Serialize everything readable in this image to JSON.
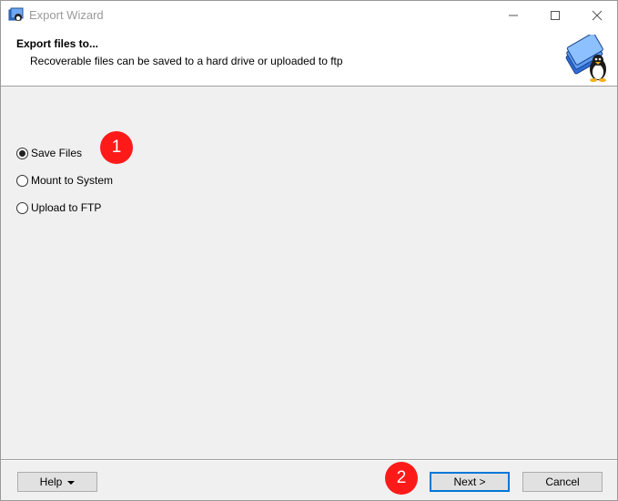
{
  "window": {
    "title": "Export Wizard",
    "controls": {
      "minimize": "—",
      "maximize": "☐",
      "close": "✕"
    }
  },
  "header": {
    "title": "Export files to...",
    "subtitle": "Recoverable files can be saved to a hard drive or uploaded to ftp"
  },
  "options": [
    {
      "label": "Save Files",
      "checked": true
    },
    {
      "label": "Mount to System",
      "checked": false
    },
    {
      "label": "Upload to FTP",
      "checked": false
    }
  ],
  "annotations": [
    {
      "label": "1"
    },
    {
      "label": "2"
    }
  ],
  "buttons": {
    "help": "Help",
    "next": "Next >",
    "cancel": "Cancel"
  },
  "colors": {
    "badge": "#ff1a1a",
    "focus_border": "#0078d7",
    "background": "#f0f0f0"
  },
  "icons": {
    "app": "wizard-app-icon",
    "header": "penguin-folder-icon"
  }
}
